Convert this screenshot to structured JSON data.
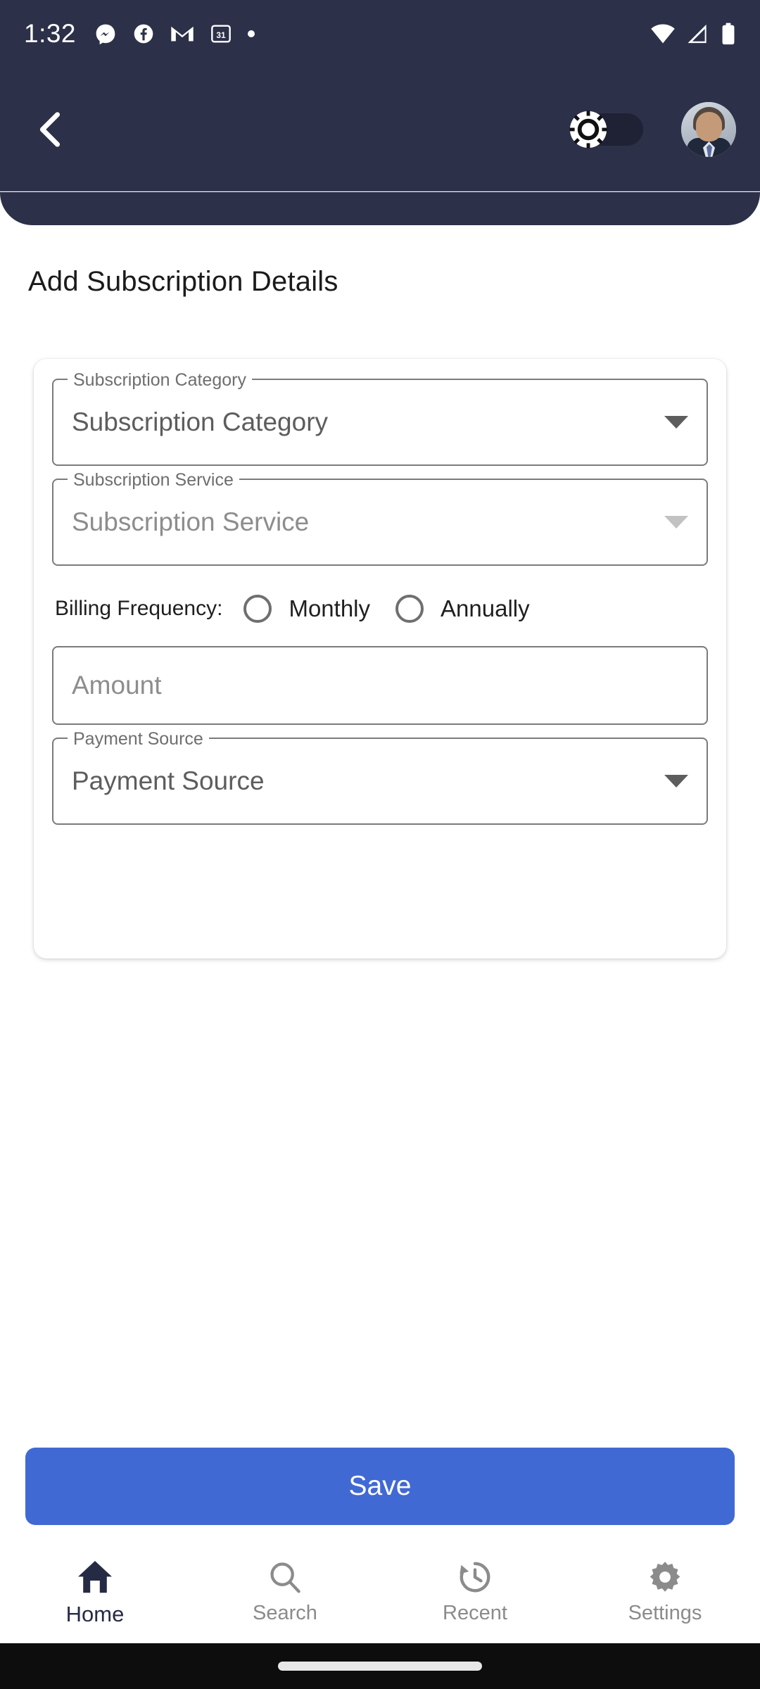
{
  "status_bar": {
    "time": "1:32",
    "left_icons": [
      "messenger-icon",
      "facebook-icon",
      "gmail-icon",
      "calendar-31-icon",
      "notification-dot-icon"
    ],
    "calendar_day": "31",
    "right_icons": [
      "wifi-icon",
      "cellular-signal-icon",
      "battery-icon"
    ],
    "background": "#2c3048"
  },
  "app_bar": {
    "back_icon": "chevron-left-icon",
    "theme_toggle": {
      "icon": "sun-icon",
      "state": "off",
      "track_color": "#1f2235"
    },
    "avatar": "user-avatar",
    "background": "#2c3048"
  },
  "page": {
    "title": "Add Subscription Details"
  },
  "form": {
    "fields": [
      {
        "name": "subscription-category",
        "legend": "Subscription Category",
        "value": "Subscription Category",
        "type": "dropdown",
        "caret_icon": "chevron-down-icon",
        "enabled": true
      },
      {
        "name": "subscription-service",
        "legend": "Subscription Service",
        "value": "Subscription Service",
        "type": "dropdown",
        "caret_icon": "chevron-down-icon",
        "enabled": false
      },
      {
        "name": "payment-source",
        "legend": "Payment Source",
        "value": "Payment Source",
        "type": "dropdown",
        "caret_icon": "chevron-down-icon",
        "enabled": true
      }
    ],
    "billing": {
      "label": "Billing Frequency:",
      "options": [
        {
          "label": "Monthly",
          "selected": false
        },
        {
          "label": "Annually",
          "selected": false
        }
      ]
    },
    "amount": {
      "placeholder": "Amount",
      "value": ""
    }
  },
  "actions": {
    "save_label": "Save",
    "save_color": "#4169d4"
  },
  "bottom_nav": {
    "items": [
      {
        "label": "Home",
        "icon": "home-icon",
        "active": true
      },
      {
        "label": "Search",
        "icon": "search-icon",
        "active": false
      },
      {
        "label": "Recent",
        "icon": "history-icon",
        "active": false
      },
      {
        "label": "Settings",
        "icon": "gear-icon",
        "active": false
      }
    ]
  }
}
